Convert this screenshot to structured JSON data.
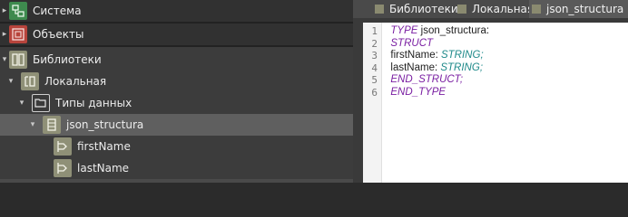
{
  "tree": {
    "categories": [
      {
        "label": "Система"
      },
      {
        "label": "Объекты"
      }
    ],
    "library": {
      "label": "Библиотеки"
    },
    "local": {
      "label": "Локальная"
    },
    "datatypes": {
      "label": "Типы данных"
    },
    "struct": {
      "label": "json_structura"
    },
    "fields": [
      {
        "label": "firstName"
      },
      {
        "label": "lastName"
      }
    ]
  },
  "tabs": [
    {
      "label": "Библиотеки"
    },
    {
      "label": "Локальная"
    },
    {
      "label": "json_structura",
      "active": true
    }
  ],
  "code": {
    "line_numbers": [
      "1",
      "2",
      "3",
      "4",
      "5",
      "6"
    ],
    "lines": [
      {
        "kw": "TYPE",
        "rest": " json_structura:"
      },
      {
        "kw": "STRUCT"
      },
      {
        "name": "firstName: ",
        "type": "STRING",
        "end": ";"
      },
      {
        "name": "lastName: ",
        "type": "STRING",
        "end": ";"
      },
      {
        "kw": "END_STRUCT",
        "rest": ";"
      },
      {
        "kw": "END_TYPE"
      }
    ]
  },
  "colors": {
    "keyword": "#7a1fa2",
    "type": "#1f8a8a",
    "selection": "#5f5f5f",
    "tree_bg": "#3c3c3c"
  }
}
